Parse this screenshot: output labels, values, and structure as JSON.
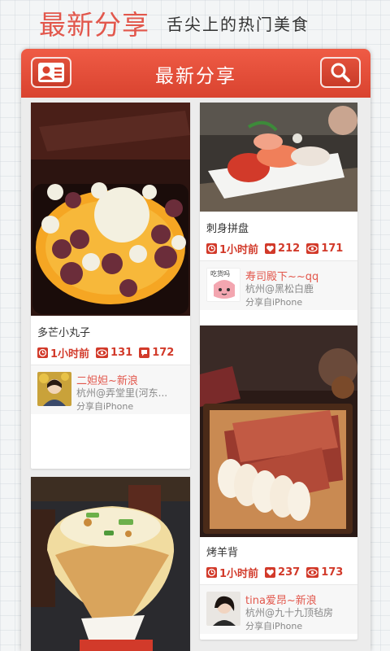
{
  "banner": {
    "title": "最新分享",
    "subtitle": "舌尖上的热门美食"
  },
  "appbar": {
    "title": "最新分享",
    "left_icon": "contacts-icon",
    "right_icon": "search-icon"
  },
  "posts": [
    {
      "caption": "多芒小丸子",
      "time": "1小时前",
      "views": "131",
      "comments": "172",
      "user": {
        "name": "二妲妲~新浪",
        "location": "杭州@弄堂里(河东...",
        "source": "分享自iPhone"
      }
    },
    {
      "caption": "刺身拼盘",
      "time": "1小时前",
      "likes": "212",
      "views": "171",
      "user": {
        "name": "寿司殿下~~qq",
        "location": "杭州@黑松白鹿",
        "source": "分享自iPhone",
        "avatar_text": "吃货吗"
      }
    },
    {
      "caption": "烤羊背",
      "time": "1小时前",
      "likes": "237",
      "views": "173",
      "user": {
        "name": "tina爱昂~新浪",
        "location": "杭州@九十九顶毡房",
        "source": "分享自iPhone"
      }
    }
  ],
  "colors": {
    "accent": "#e2574c",
    "appbar": "#d9432f"
  }
}
